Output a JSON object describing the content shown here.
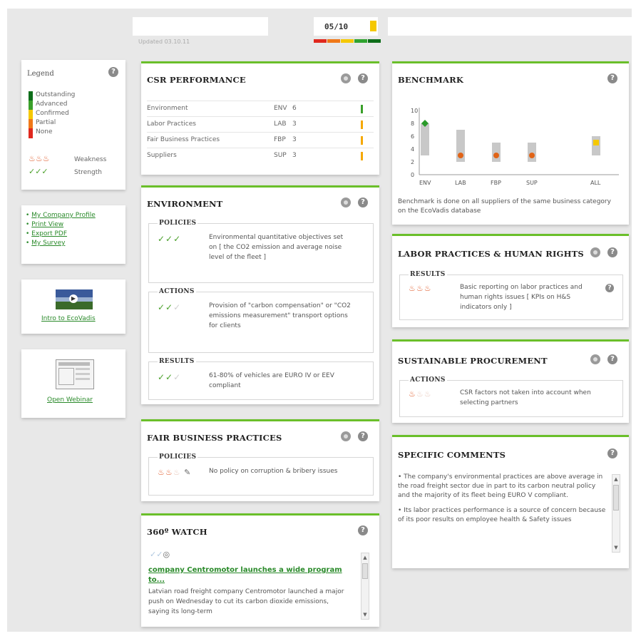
{
  "header": {
    "updated_text": "Updated 03.10.11",
    "score": "05/10",
    "score_scale_colors": [
      "#e0281e",
      "#f07818",
      "#f5c800",
      "#2fa32f",
      "#0e6e1a"
    ]
  },
  "legend": {
    "title": "Legend",
    "items": [
      {
        "label": "Outstanding",
        "color": "#0e6e1a"
      },
      {
        "label": "Advanced",
        "color": "#3aa02a"
      },
      {
        "label": "Confirmed",
        "color": "#f5c800"
      },
      {
        "label": "Partial",
        "color": "#f07818"
      },
      {
        "label": "None",
        "color": "#e0281e"
      }
    ],
    "weakness_label": "Weakness",
    "strength_label": "Strength"
  },
  "links": [
    "My Company Profile",
    "Print View",
    "Export PDF",
    "My Survey"
  ],
  "intro_video": {
    "label": "Intro to EcoVadis"
  },
  "webinar": {
    "label": "Open Webinar"
  },
  "csr_performance": {
    "title": "CSR PERFORMANCE",
    "rows": [
      {
        "name": "Environment",
        "code": "ENV",
        "score": "6",
        "color": "#3aa02a"
      },
      {
        "name": "Labor Practices",
        "code": "LAB",
        "score": "3",
        "color": "#f5a800"
      },
      {
        "name": "Fair Business Practices",
        "code": "FBP",
        "score": "3",
        "color": "#f5a800"
      },
      {
        "name": "Suppliers",
        "code": "SUP",
        "score": "3",
        "color": "#f5a800"
      }
    ]
  },
  "environment": {
    "title": "ENVIRONMENT",
    "policies": {
      "label": "POLICIES",
      "text": "Environmental quantitative objectives set on [ the CO2 emission and average noise level of the fleet ]"
    },
    "actions": {
      "label": "ACTIONS",
      "text": "Provision of \"carbon compensation\" or \"CO2 emissions measurement\" transport options for clients"
    },
    "results": {
      "label": "RESULTS",
      "text": "61-80% of vehicles are EURO IV or EEV compliant"
    }
  },
  "fair_business": {
    "title": "FAIR BUSINESS PRACTICES",
    "policies": {
      "label": "POLICIES",
      "text": "No policy on corruption & bribery issues"
    }
  },
  "watch": {
    "title": "360º WATCH",
    "headline": "company Centromotor launches a wide program to...",
    "body": "Latvian road freight company Centromotor launched a major push on Wednesday to cut its carbon dioxide emissions, saying its long-term"
  },
  "benchmark": {
    "title": "BENCHMARK",
    "note": "Benchmark is done on all suppliers of the same business category on the EcoVadis database",
    "chart_data": {
      "type": "scatter",
      "categories": [
        "ENV",
        "LAB",
        "FBP",
        "SUP",
        "ALL"
      ],
      "y_ticks": [
        "0",
        "2",
        "4",
        "6",
        "8",
        "10"
      ],
      "ylim": [
        0,
        10
      ],
      "range_low": [
        3,
        2,
        2,
        2,
        3
      ],
      "range_high": [
        8,
        7,
        5,
        5,
        6
      ],
      "company_scores": [
        8,
        3,
        3,
        3,
        5
      ],
      "marker_colors": [
        "#2a9a2a",
        "#e06418",
        "#e06418",
        "#e06418",
        "#f5c800"
      ],
      "marker_shapes": [
        "diamond",
        "circle",
        "circle",
        "circle",
        "square"
      ]
    }
  },
  "labor": {
    "title": "LABOR PRACTICES & HUMAN RIGHTS",
    "results": {
      "label": "RESULTS",
      "text": "Basic reporting on labor practices and human rights issues [ KPIs on H&S indicators only ]"
    }
  },
  "procurement": {
    "title": "SUSTAINABLE PROCUREMENT",
    "actions": {
      "label": "ACTIONS",
      "text": "CSR factors not taken into account when selecting partners"
    }
  },
  "comments": {
    "title": "SPECIFIC COMMENTS",
    "p1": "• The company's environmental practices are above average in the road freight sector due in part to its carbon neutral policy and the majority of its fleet being EURO V compliant.",
    "p2": "• Its labor practices performance is a source of concern because of its poor results on employee health & Safety issues"
  }
}
